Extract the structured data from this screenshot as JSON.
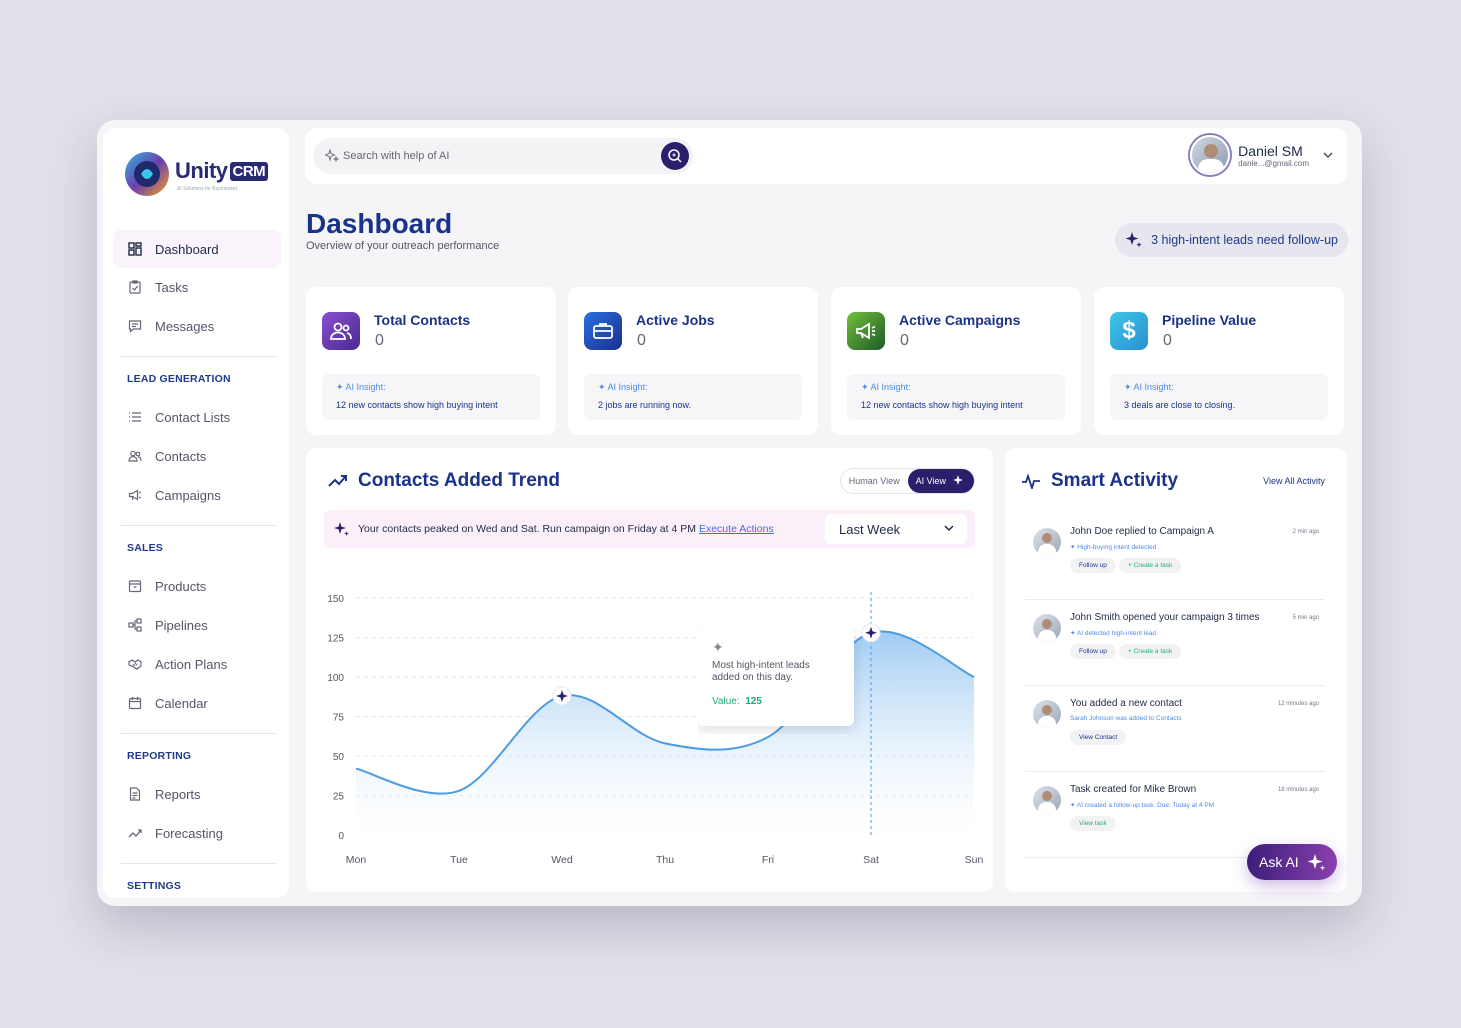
{
  "app": {
    "logo_name": "Unity",
    "logo_suffix": "CRM",
    "logo_tagline": "AI Solutions for Businesses"
  },
  "colors": {
    "primary": "#1a3388",
    "accent": "#2b1f6b",
    "insight": "#4f8be8",
    "success": "#1fae7a"
  },
  "sidebar": {
    "items": [
      {
        "label": "Dashboard",
        "icon": "grid-icon",
        "active": true
      },
      {
        "label": "Tasks",
        "icon": "clipboard-icon"
      },
      {
        "label": "Messages",
        "icon": "chat-icon"
      }
    ],
    "lead_generation": {
      "heading": "LEAD GENERATION",
      "items": [
        {
          "label": "Contact Lists",
          "icon": "list-icon"
        },
        {
          "label": "Contacts",
          "icon": "users-icon"
        },
        {
          "label": "Campaigns",
          "icon": "megaphone-icon"
        }
      ]
    },
    "sales": {
      "heading": "SALES",
      "items": [
        {
          "label": "Products",
          "icon": "box-icon"
        },
        {
          "label": "Pipelines",
          "icon": "pipeline-icon"
        },
        {
          "label": "Action Plans",
          "icon": "handshake-icon"
        },
        {
          "label": "Calendar",
          "icon": "calendar-icon"
        }
      ]
    },
    "reporting": {
      "heading": "REPORTING",
      "items": [
        {
          "label": "Reports",
          "icon": "document-icon"
        },
        {
          "label": "Forecasting",
          "icon": "trend-icon"
        }
      ]
    },
    "settings_heading": "SETTINGS"
  },
  "search": {
    "placeholder": "Search with help of AI"
  },
  "user": {
    "name": "Daniel SM",
    "email": "danie...@gmail.com"
  },
  "header": {
    "title": "Dashboard",
    "subtitle": "Overview of your outreach performance",
    "alert": "3 high-intent leads need follow-up"
  },
  "stats": [
    {
      "title": "Total Contacts",
      "value": "0",
      "insight_label": "AI Insight:",
      "insight": "12 new contacts show high buying intent",
      "icon": "users-icon",
      "color": "#6b3fb0"
    },
    {
      "title": "Active Jobs",
      "value": "0",
      "insight_label": "AI Insight:",
      "insight": "2 jobs are running now.",
      "icon": "briefcase-icon",
      "color": "#1f4fb8"
    },
    {
      "title": "Active Campaigns",
      "value": "0",
      "insight_label": "AI Insight:",
      "insight": "12 new contacts show high buying intent",
      "icon": "megaphone-icon",
      "color": "#3f8f2f"
    },
    {
      "title": "Pipeline Value",
      "value": "0",
      "insight_label": "AI Insight:",
      "insight": "3 deals are close to closing.",
      "icon": "dollar-icon",
      "color": "#2fa9d8"
    }
  ],
  "trend": {
    "title": "Contacts Added Trend",
    "human_view": "Human View",
    "ai_view": "AI View",
    "banner": "Your contacts peaked on Wed and Sat. Run campaign on Friday at 4 PM",
    "banner_link": "Execute Actions",
    "range": "Last Week",
    "tooltip_text": "Most high-intent leads added on this day.",
    "tooltip_label": "Value:",
    "tooltip_value": "125"
  },
  "chart_data": {
    "type": "area",
    "categories": [
      "Mon",
      "Tue",
      "Wed",
      "Thu",
      "Fri",
      "Sat",
      "Sun"
    ],
    "values": [
      42,
      28,
      88,
      58,
      62,
      128,
      100
    ],
    "ylim": [
      0,
      150
    ],
    "yticks": [
      0,
      25,
      50,
      75,
      100,
      125,
      150
    ],
    "highlighted": [
      "Wed",
      "Sat"
    ],
    "grid": true,
    "xlabel": "",
    "ylabel": "",
    "title": ""
  },
  "activity": {
    "title": "Smart Activity",
    "view_all": "View All Activity",
    "items": [
      {
        "title": "John Doe replied to Campaign A",
        "time": "2 min ago",
        "insight": "High-buying intent detected",
        "btn1": "Follow up",
        "btn2": "Create a task"
      },
      {
        "title": "John Smith opened your campaign 3 times",
        "time": "5 min ago",
        "insight": "AI detected high-intent lead",
        "btn1": "Follow up",
        "btn2": "Create a task"
      },
      {
        "title": "You added a new contact",
        "time": "12 minutes ago",
        "insight": "Sarah Johnson was added to Contacts",
        "btn1": "View Contact"
      },
      {
        "title": "Task created for Mike Brown",
        "time": "18 minutes ago",
        "insight": "AI created a follow-up task. Due: Today at 4 PM",
        "btn2": "View task"
      }
    ]
  },
  "ask_ai": "Ask AI"
}
